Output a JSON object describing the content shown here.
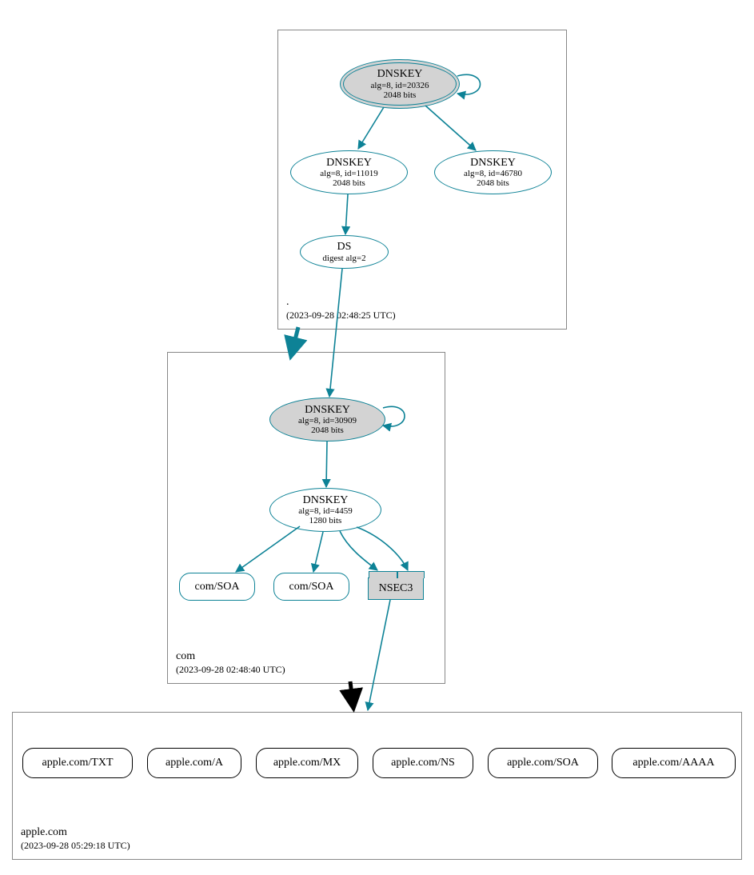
{
  "zones": {
    "root": {
      "name": ".",
      "ts": "(2023-09-28 02:48:25 UTC)"
    },
    "com": {
      "name": "com",
      "ts": "(2023-09-28 02:48:40 UTC)"
    },
    "apple": {
      "name": "apple.com",
      "ts": "(2023-09-28 05:29:18 UTC)"
    }
  },
  "nodes": {
    "root_ksk": {
      "title": "DNSKEY",
      "l1": "alg=8, id=20326",
      "l2": "2048 bits"
    },
    "root_zsk": {
      "title": "DNSKEY",
      "l1": "alg=8, id=11019",
      "l2": "2048 bits"
    },
    "root_k2": {
      "title": "DNSKEY",
      "l1": "alg=8, id=46780",
      "l2": "2048 bits"
    },
    "root_ds": {
      "title": "DS",
      "l1": "digest alg=2"
    },
    "com_ksk": {
      "title": "DNSKEY",
      "l1": "alg=8, id=30909",
      "l2": "2048 bits"
    },
    "com_zsk": {
      "title": "DNSKEY",
      "l1": "alg=8, id=4459",
      "l2": "1280 bits"
    },
    "com_soa1": {
      "title": "com/SOA"
    },
    "com_soa2": {
      "title": "com/SOA"
    },
    "nsec3": {
      "title": "NSEC3"
    },
    "a_txt": {
      "title": "apple.com/TXT"
    },
    "a_a": {
      "title": "apple.com/A"
    },
    "a_mx": {
      "title": "apple.com/MX"
    },
    "a_ns": {
      "title": "apple.com/NS"
    },
    "a_soa": {
      "title": "apple.com/SOA"
    },
    "a_aaaa": {
      "title": "apple.com/AAAA"
    }
  },
  "colors": {
    "teal": "#0d8296",
    "grey": "#d3d3d3"
  }
}
